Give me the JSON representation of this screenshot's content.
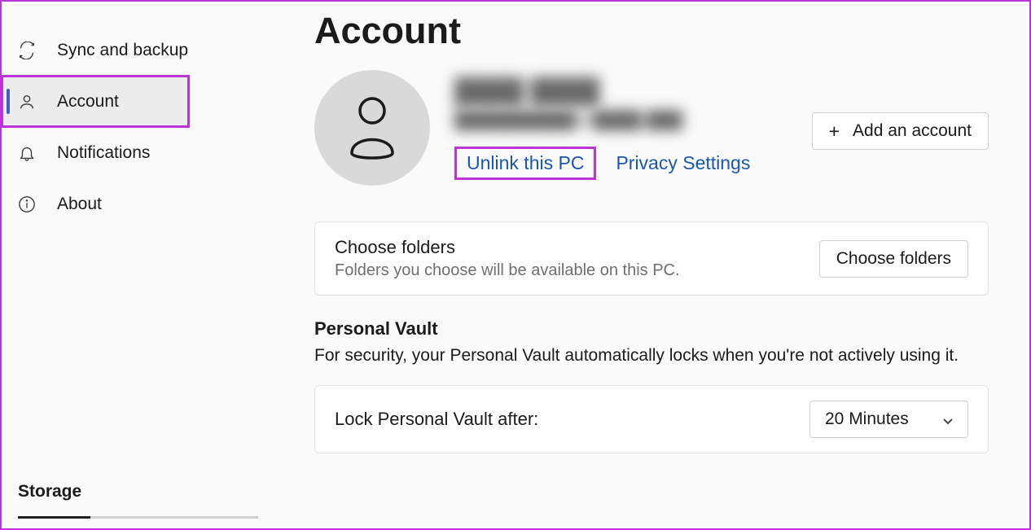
{
  "sidebar": {
    "items": [
      {
        "label": "Sync and backup"
      },
      {
        "label": "Account"
      },
      {
        "label": "Notifications"
      },
      {
        "label": "About"
      }
    ],
    "storage_heading": "Storage"
  },
  "main": {
    "title": "Account",
    "account": {
      "display_name_redacted": "████ ████",
      "email_redacted": "██████████@████.███",
      "unlink_label": "Unlink this PC",
      "privacy_label": "Privacy Settings",
      "add_account_label": "Add an account"
    },
    "choose_folders": {
      "title": "Choose folders",
      "desc": "Folders you choose will be available on this PC.",
      "button": "Choose folders"
    },
    "personal_vault": {
      "title": "Personal Vault",
      "desc": "For security, your Personal Vault automatically locks when you're not actively using it.",
      "lock_after_label": "Lock Personal Vault after:",
      "lock_after_value": "20 Minutes"
    }
  }
}
